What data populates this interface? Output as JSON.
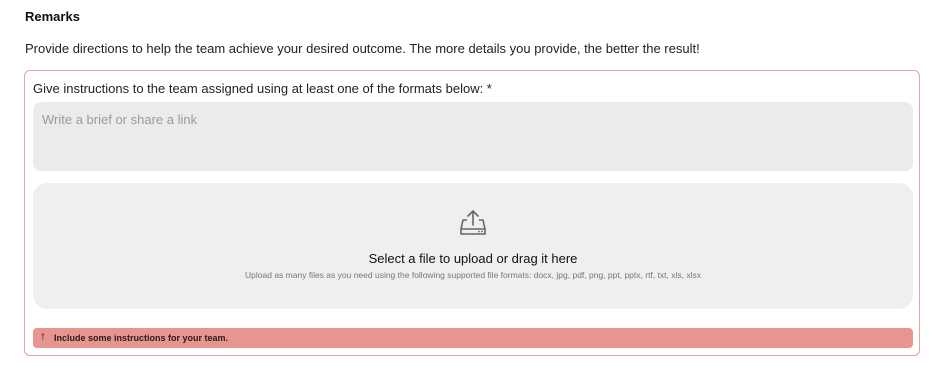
{
  "section": {
    "title": "Remarks",
    "description": "Provide directions to help the team achieve your desired outcome. The more details you provide, the better the result!"
  },
  "instructions": {
    "label": "Give instructions to the team assigned using at least one of the formats below: *",
    "brief_placeholder": "Write a brief or share a link",
    "brief_value": ""
  },
  "upload": {
    "icon": "upload-tray-icon",
    "title": "Select a file to upload or drag it here",
    "subtitle": "Upload as many files as you need using the following supported file formats: docx, jpg, pdf, png, ppt, pptx, rtf, txt, xls, xlsx"
  },
  "error": {
    "icon": "arrow-up-icon",
    "message": "Include some instructions for your team."
  },
  "colors": {
    "error_border": "#e7a2a2",
    "error_bg": "#e8958f",
    "input_bg": "#ebebeb",
    "dropzone_bg": "#efeff1"
  }
}
